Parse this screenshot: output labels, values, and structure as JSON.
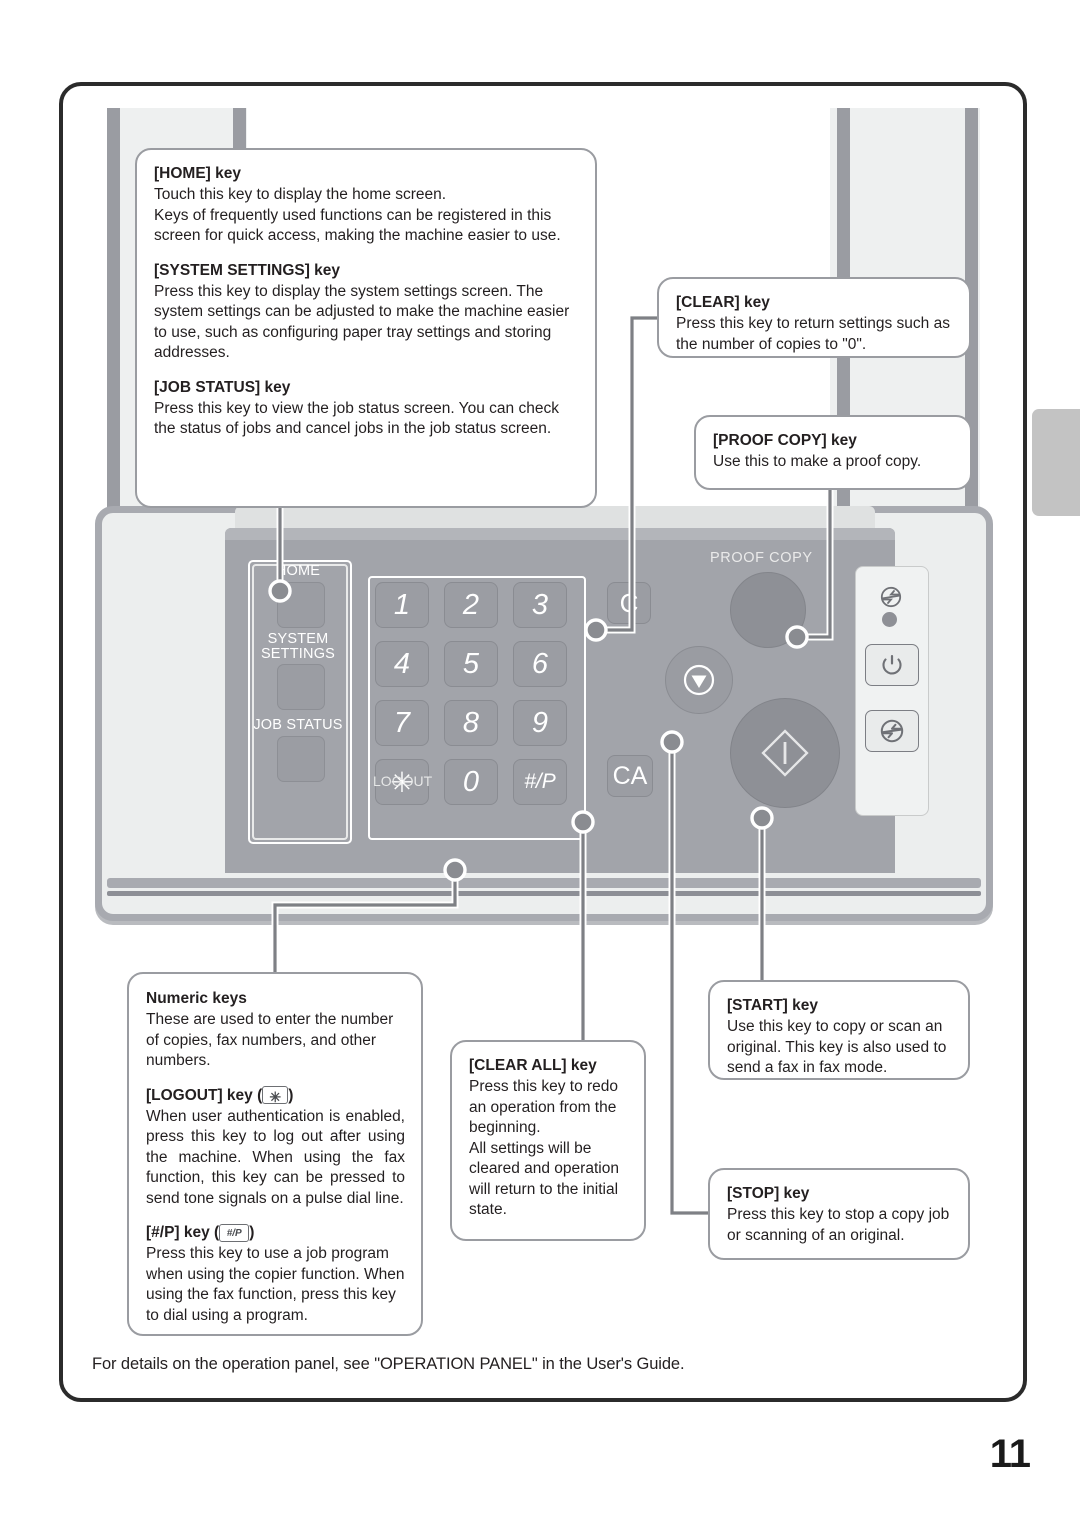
{
  "document": {
    "page_number": "11",
    "footer_note": "For details on the operation panel, see \"OPERATION PANEL\" in the User's Guide."
  },
  "callouts": {
    "home": {
      "title": "[HOME] key",
      "body": "Touch this key to display the home screen.\nKeys of frequently used functions can be registered in this screen for quick access, making the machine easier to use."
    },
    "system_settings": {
      "title": "[SYSTEM SETTINGS] key",
      "body": "Press this key to display the system settings screen. The system settings can be adjusted to make the machine easier to use, such as configuring paper tray settings and storing addresses."
    },
    "job_status": {
      "title": "[JOB STATUS] key",
      "body": "Press this key to view the job status screen. You can check the status of jobs and cancel jobs in the job status screen."
    },
    "clear": {
      "title": "[CLEAR] key",
      "body": "Press this key to return settings such as the number of copies to \"0\"."
    },
    "proof_copy": {
      "title": "[PROOF COPY] key",
      "body": "Use this to make a proof copy."
    },
    "numeric_keys": {
      "title": "Numeric keys",
      "body": "These are used to enter the number of copies, fax numbers, and other numbers."
    },
    "logout": {
      "title_prefix": "[LOGOUT] key (",
      "key_glyph": "✳",
      "title_suffix": ")",
      "body": "When user authentication is enabled, press this key to log out after using the machine. When using the fax function, this key can be pressed to send tone signals on a pulse dial line."
    },
    "hash_p": {
      "title_prefix": "[#/P] key (",
      "key_glyph": "#/P",
      "title_suffix": ")",
      "body": "Press this key to use a job program when using the copier function. When using the fax function, press this key to dial using a program."
    },
    "clear_all": {
      "title": "[CLEAR ALL] key",
      "body_1": "Press this key to redo an operation from the beginning.",
      "body_2": "All settings will be cleared and operation will return to the initial state."
    },
    "start": {
      "title": "[START] key",
      "body": "Use this key to copy or scan an original. This key is also used to send a fax in fax mode."
    },
    "stop": {
      "title": "[STOP] key",
      "body": "Press this key to stop a copy job or scanning of an original."
    }
  },
  "operation_panel": {
    "soft_keys": [
      {
        "label": "HOME"
      },
      {
        "label": "SYSTEM\nSETTINGS"
      },
      {
        "label": "JOB STATUS"
      }
    ],
    "soft_key_labels": {
      "home": "HOME",
      "system": "SYSTEM",
      "settings": "SETTINGS",
      "job_status": "JOB STATUS"
    },
    "numeric_keys": [
      "1",
      "2",
      "3",
      "4",
      "5",
      "6",
      "7",
      "8",
      "9",
      "✳",
      "0",
      "#/P"
    ],
    "logout_label": "LOGOUT",
    "clear_key": "C",
    "clear_all_key": "CA",
    "proof_copy_label": "PROOF COPY"
  },
  "colors": {
    "panel_grey": "#a2a4aa",
    "key_grey": "#9b9da3",
    "callout_border": "#9a9ca1",
    "frame_black": "#2b2b2b",
    "margin_tab": "#c3c3c3"
  }
}
